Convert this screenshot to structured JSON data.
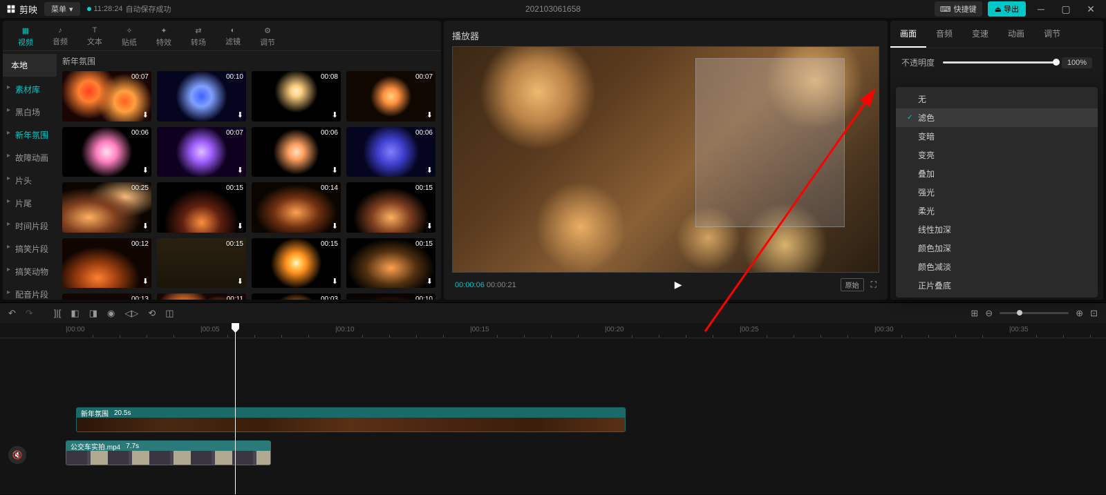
{
  "titlebar": {
    "app_name": "剪映",
    "menu": "菜单",
    "autosave_time": "11:28:24",
    "autosave_text": "自动保存成功",
    "project": "202103061658",
    "shortcut": "快捷键",
    "export": "导出"
  },
  "top_tabs": [
    {
      "label": "视频",
      "active": true
    },
    {
      "label": "音频"
    },
    {
      "label": "文本"
    },
    {
      "label": "贴纸"
    },
    {
      "label": "特效"
    },
    {
      "label": "转场"
    },
    {
      "label": "滤镜"
    },
    {
      "label": "调节"
    }
  ],
  "left_sidebar": {
    "section": "本地",
    "items": [
      "素材库",
      "黑白场",
      "新年氛围",
      "故障动画",
      "片头",
      "片尾",
      "时间片段",
      "搞笑片段",
      "搞笑动物",
      "配音片段"
    ],
    "active_index": 0,
    "highlight_index": 2
  },
  "gallery": {
    "title": "新年氛围",
    "clips": [
      {
        "dur": "00:07",
        "cls": "fw1"
      },
      {
        "dur": "00:10",
        "cls": "fw2"
      },
      {
        "dur": "00:08",
        "cls": "fw3"
      },
      {
        "dur": "00:07",
        "cls": "fw4"
      },
      {
        "dur": "00:06",
        "cls": "fw5"
      },
      {
        "dur": "00:07",
        "cls": "fw6"
      },
      {
        "dur": "00:06",
        "cls": "fw7"
      },
      {
        "dur": "00:06",
        "cls": "fw8"
      },
      {
        "dur": "00:25",
        "cls": "sp1"
      },
      {
        "dur": "00:15",
        "cls": "sp2"
      },
      {
        "dur": "00:14",
        "cls": "sp3"
      },
      {
        "dur": "00:15",
        "cls": "sp4"
      },
      {
        "dur": "00:12",
        "cls": "sp5"
      },
      {
        "dur": "00:15",
        "cls": "sp6"
      },
      {
        "dur": "00:15",
        "cls": "sp7"
      },
      {
        "dur": "00:15",
        "cls": "sp8"
      },
      {
        "dur": "00:13",
        "cls": "sp5"
      },
      {
        "dur": "00:11",
        "cls": "fw1"
      },
      {
        "dur": "00:03",
        "cls": "sp7"
      },
      {
        "dur": "00:10",
        "cls": "sp3"
      }
    ]
  },
  "player": {
    "title": "播放器",
    "current": "00:00:06",
    "duration": "00:00:21",
    "ratio": "原始"
  },
  "right_panel": {
    "tabs": [
      "画面",
      "音频",
      "变速",
      "动画",
      "调节"
    ],
    "active_tab": 0,
    "opacity_label": "不透明度",
    "opacity_value": "100%",
    "blend_dropdown": [
      "无",
      "滤色",
      "变暗",
      "变亮",
      "叠加",
      "强光",
      "柔光",
      "线性加深",
      "颜色加深",
      "颜色减淡",
      "正片叠底"
    ],
    "blend_selected_index": 1,
    "blend_select_label": "滤色",
    "opacity2_label": "不透明度",
    "opacity2_value": "100%"
  },
  "ruler_marks": [
    "|00:00",
    "|00:05",
    "|00:10",
    "|00:15",
    "|00:20",
    "|00:25",
    "|00:30",
    "|00:35"
  ],
  "timeline": {
    "clip1": {
      "name": "新年氛围",
      "dur": "20.5s"
    },
    "clip2": {
      "name": "公交车实拍.mp4",
      "dur": "7.7s"
    }
  }
}
